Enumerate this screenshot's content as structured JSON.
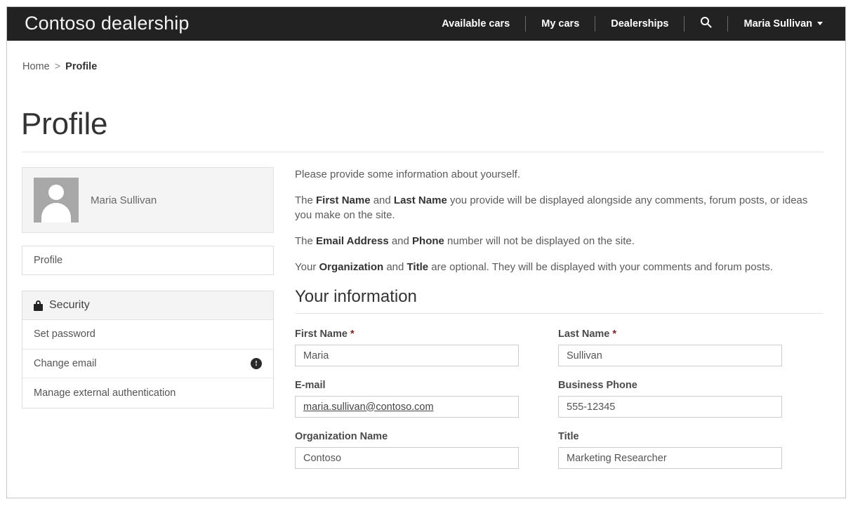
{
  "navbar": {
    "brand": "Contoso dealership",
    "links": [
      {
        "label": "Available cars"
      },
      {
        "label": "My cars"
      },
      {
        "label": "Dealerships"
      }
    ],
    "search_icon": "search-icon",
    "user": {
      "name": "Maria Sullivan",
      "caret": "chevron-down-icon"
    }
  },
  "breadcrumb": {
    "home": "Home",
    "separator": ">",
    "current": "Profile"
  },
  "page": {
    "title": "Profile"
  },
  "sidebar": {
    "profile_card": {
      "avatar_icon": "user-avatar-placeholder-icon",
      "name": "Maria Sullivan"
    },
    "profile_nav": [
      {
        "label": "Profile"
      }
    ],
    "security": {
      "icon": "lock-icon",
      "header": "Security",
      "items": [
        {
          "label": "Set password",
          "badge": null
        },
        {
          "label": "Change email",
          "badge": "!"
        },
        {
          "label": "Manage external authentication",
          "badge": null
        }
      ]
    }
  },
  "main": {
    "intro": [
      {
        "parts": [
          {
            "t": "Please provide some information about yourself.",
            "b": false
          }
        ]
      },
      {
        "parts": [
          {
            "t": "The ",
            "b": false
          },
          {
            "t": "First Name",
            "b": true
          },
          {
            "t": " and ",
            "b": false
          },
          {
            "t": "Last Name",
            "b": true
          },
          {
            "t": " you provide will be displayed alongside any comments, forum posts, or ideas you make on the site.",
            "b": false
          }
        ]
      },
      {
        "parts": [
          {
            "t": "The ",
            "b": false
          },
          {
            "t": "Email Address",
            "b": true
          },
          {
            "t": " and ",
            "b": false
          },
          {
            "t": "Phone",
            "b": true
          },
          {
            "t": " number will not be displayed on the site.",
            "b": false
          }
        ]
      },
      {
        "parts": [
          {
            "t": "Your ",
            "b": false
          },
          {
            "t": "Organization",
            "b": true
          },
          {
            "t": " and ",
            "b": false
          },
          {
            "t": "Title",
            "b": true
          },
          {
            "t": " are optional. They will be displayed with your comments and forum posts.",
            "b": false
          }
        ]
      }
    ],
    "section_heading": "Your information",
    "fields": [
      {
        "label": "First Name",
        "required": true,
        "value": "Maria",
        "name": "first-name",
        "link": false
      },
      {
        "label": "Last Name",
        "required": true,
        "value": "Sullivan",
        "name": "last-name",
        "link": false
      },
      {
        "label": "E-mail",
        "required": false,
        "value": "maria.sullivan@contoso.com",
        "name": "email",
        "link": true
      },
      {
        "label": "Business Phone",
        "required": false,
        "value": "555-12345",
        "name": "business-phone",
        "link": false
      },
      {
        "label": "Organization Name",
        "required": false,
        "value": "Contoso",
        "name": "organization-name",
        "link": false
      },
      {
        "label": "Title",
        "required": false,
        "value": "Marketing Researcher",
        "name": "title",
        "link": false
      }
    ]
  },
  "colors": {
    "navbar_bg": "#222222",
    "required_star": "#8b2020",
    "panel_bg": "#f4f4f4",
    "border": "#dddddd"
  }
}
